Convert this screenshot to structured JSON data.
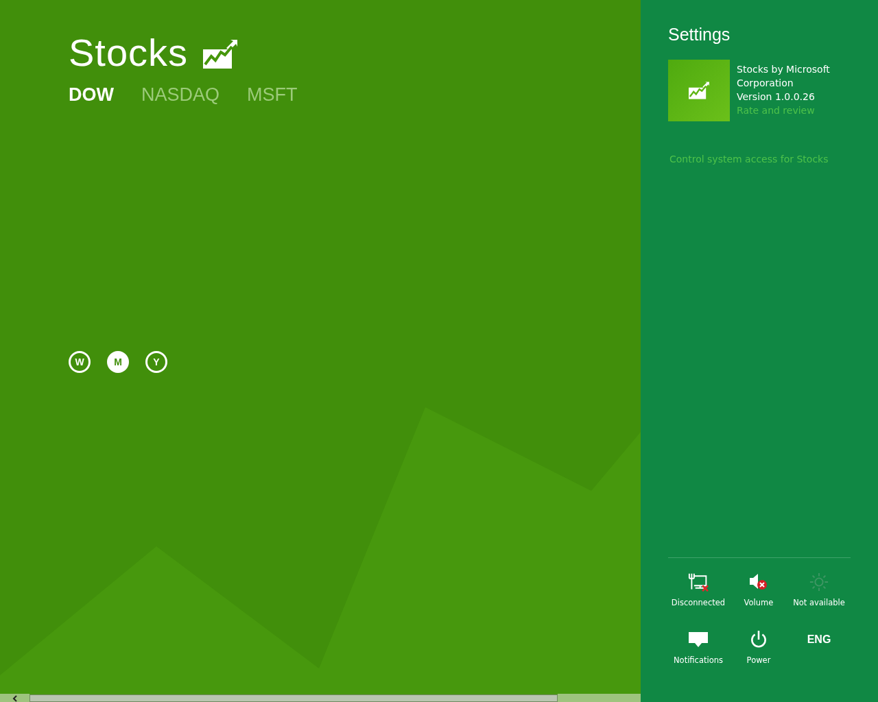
{
  "app": {
    "title": "Stocks",
    "tabs": [
      {
        "label": "DOW",
        "selected": true
      },
      {
        "label": "NASDAQ",
        "selected": false
      },
      {
        "label": "MSFT",
        "selected": false
      }
    ],
    "ranges": [
      {
        "label": "W",
        "selected": false
      },
      {
        "label": "M",
        "selected": true
      },
      {
        "label": "Y",
        "selected": false
      }
    ]
  },
  "settings": {
    "title": "Settings",
    "app_info": {
      "publisher": "Stocks by Microsoft Corporation",
      "version": "Version 1.0.0.26",
      "link": "Rate and review"
    },
    "permissions_link": "Control system access for Stocks",
    "quick_settings": [
      {
        "kind": "network",
        "label": "Disconnected",
        "disabled": false
      },
      {
        "kind": "volume",
        "label": "Volume",
        "disabled": false
      },
      {
        "kind": "brightness",
        "label": "Not available",
        "disabled": true
      },
      {
        "kind": "notifications",
        "label": "Notifications",
        "disabled": false
      },
      {
        "kind": "power",
        "label": "Power",
        "disabled": false
      },
      {
        "kind": "language",
        "text": "ENG",
        "disabled": false
      }
    ]
  }
}
